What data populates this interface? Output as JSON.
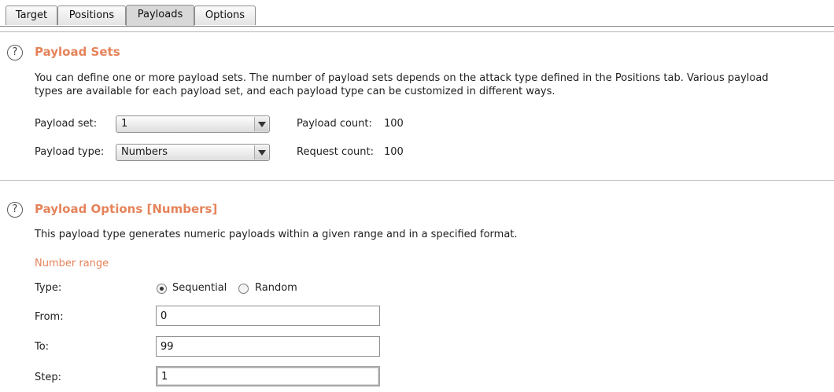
{
  "tabs": [
    {
      "label": "Target"
    },
    {
      "label": "Positions"
    },
    {
      "label": "Payloads"
    },
    {
      "label": "Options"
    }
  ],
  "help_glyph": "?",
  "payload_sets": {
    "title": "Payload Sets",
    "desc_line1": "You can define one or more payload sets. The number of payload sets depends on the attack type defined in the Positions tab. Various payload",
    "desc_line2": "types are available for each payload set, and each payload type can be customized in different ways.",
    "set_label": "Payload set:",
    "set_value": "1",
    "type_label": "Payload type:",
    "type_value": "Numbers",
    "payload_count_label": "Payload count:",
    "payload_count": "100",
    "request_count_label": "Request count:",
    "request_count": "100"
  },
  "payload_options": {
    "title": "Payload Options [Numbers]",
    "desc": "This payload type generates numeric payloads within a given range and in a specified format.",
    "number_range": "Number range",
    "type_label": "Type:",
    "sequential": "Sequential",
    "random": "Random",
    "from_label": "From:",
    "from_value": "0",
    "to_label": "To:",
    "to_value": "99",
    "step_label": "Step:",
    "step_value": "1"
  },
  "colors": {
    "accent": "#e5835a",
    "text": "#1f1f1f"
  },
  "icons": [
    "help-icon",
    "dropdown-arrow-icon"
  ]
}
